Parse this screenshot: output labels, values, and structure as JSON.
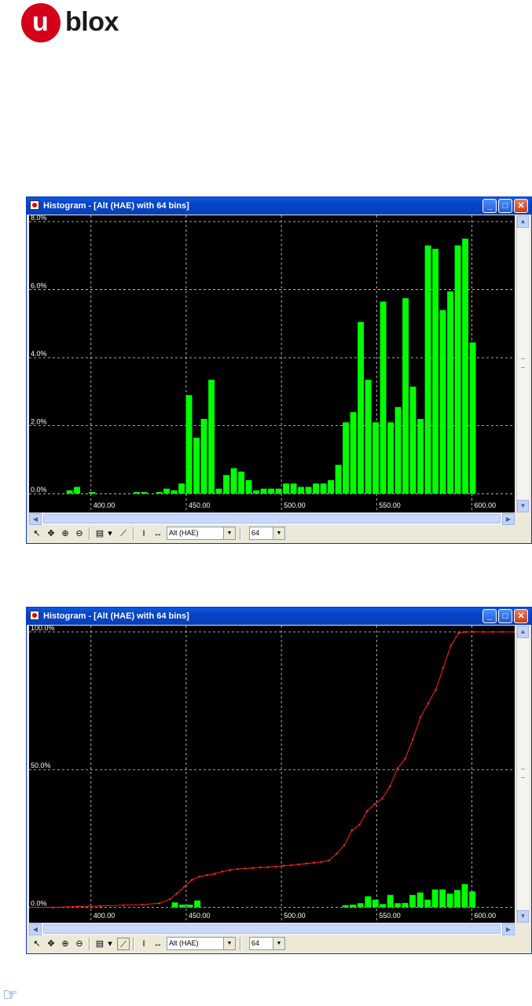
{
  "logo": {
    "letter": "u",
    "rest": "blox"
  },
  "windows": [
    {
      "title": "Histogram - [Alt (HAE) with 64 bins]",
      "toolbar": {
        "field_select": "Alt (HAE)",
        "bins_select": "64"
      },
      "chart_data": {
        "type": "bar",
        "x_ticks": [
          "400.00",
          "450.00",
          "500.00",
          "550.00",
          "600.00"
        ],
        "y_ticks": [
          "0.0%",
          "2.0%",
          "4.0%",
          "6.0%",
          "8.0%"
        ],
        "xlim": [
          367.5,
          622.5
        ],
        "ylim": [
          -0.18,
          8.0
        ],
        "bin_width": 3.92,
        "bin_start": 386.9,
        "values": [
          0.1,
          0.2,
          0,
          0.05,
          0,
          0,
          0,
          0,
          0,
          0.05,
          0.05,
          0,
          0.05,
          0.15,
          0.1,
          0.3,
          2.9,
          1.65,
          2.2,
          3.35,
          0.15,
          0.55,
          0.75,
          0.65,
          0.4,
          0.1,
          0.15,
          0.15,
          0.15,
          0.3,
          0.3,
          0.2,
          0.2,
          0.3,
          0.3,
          0.4,
          0.85,
          2.1,
          2.4,
          5.05,
          3.35,
          2.1,
          5.65,
          2.1,
          2.55,
          5.75,
          3.15,
          2.2,
          7.3,
          7.2,
          5.4,
          5.95,
          7.3,
          7.5,
          4.45,
          0,
          0,
          0,
          0,
          0,
          0,
          0,
          0,
          0
        ]
      }
    },
    {
      "title": "Histogram - [Alt (HAE) with 64 bins]",
      "toolbar": {
        "field_select": "Alt (HAE)",
        "bins_select": "64"
      },
      "chart_data": {
        "type": "bar+line",
        "x_ticks": [
          "400.00",
          "450.00",
          "500.00",
          "550.00",
          "600.00"
        ],
        "y_ticks": [
          "0.0%",
          "50.0%",
          "100.0%"
        ],
        "xlim": [
          367.5,
          622.5
        ],
        "ylim": [
          -1,
          100
        ],
        "bin_width": 3.92,
        "bar_bins_x": [
          442.2,
          446.1,
          450.0,
          454.0,
          531.8,
          535.7,
          539.6,
          543.6,
          547.5,
          551.4,
          555.3,
          559.2,
          563.1,
          567.0,
          571.0,
          574.9,
          578.8,
          582.7,
          586.6,
          590.5,
          594.4,
          598.4
        ],
        "bar_values": [
          1.8,
          1.0,
          1.0,
          2.5,
          0.8,
          1.0,
          1.5,
          4.0,
          2.8,
          1.2,
          4.5,
          1.5,
          1.6,
          4.5,
          5.4,
          2.8,
          6.5,
          6.5,
          5.0,
          6.3,
          8.4,
          5.8
        ],
        "cdf_line": {
          "x": [
            367.5,
            380,
            393,
            405,
            417,
            427,
            436,
            441.5,
            445,
            449,
            453,
            457,
            461,
            465,
            469,
            473,
            477,
            481,
            485,
            489,
            493,
            497,
            501,
            505,
            509,
            513,
            517,
            521,
            525,
            529,
            533,
            537,
            541,
            545,
            549,
            553,
            557,
            561,
            565,
            569,
            573,
            577,
            581,
            585,
            589,
            593,
            597,
            601,
            606,
            611,
            616,
            622.5
          ],
          "y": [
            0,
            0,
            0.3,
            0.5,
            0.8,
            1,
            1.5,
            3,
            5,
            7.5,
            10,
            11.2,
            11.7,
            12.2,
            13,
            13.6,
            13.9,
            14.1,
            14.3,
            14.5,
            14.6,
            14.8,
            15.1,
            15.3,
            15.6,
            15.9,
            16.2,
            16.5,
            17,
            19.5,
            22.5,
            28,
            30,
            35,
            37.5,
            39.5,
            44,
            50.5,
            54,
            61,
            69,
            74,
            79,
            87,
            95,
            99.5,
            100,
            100,
            100,
            100,
            100,
            100
          ]
        }
      }
    }
  ],
  "colors": {
    "bar": "#00ff00",
    "line": "#ff2020",
    "grid": "#d8d8d8",
    "plot_bg": "#000000",
    "axis_text": "#ffffff",
    "title_bar": "#0a54d9"
  }
}
